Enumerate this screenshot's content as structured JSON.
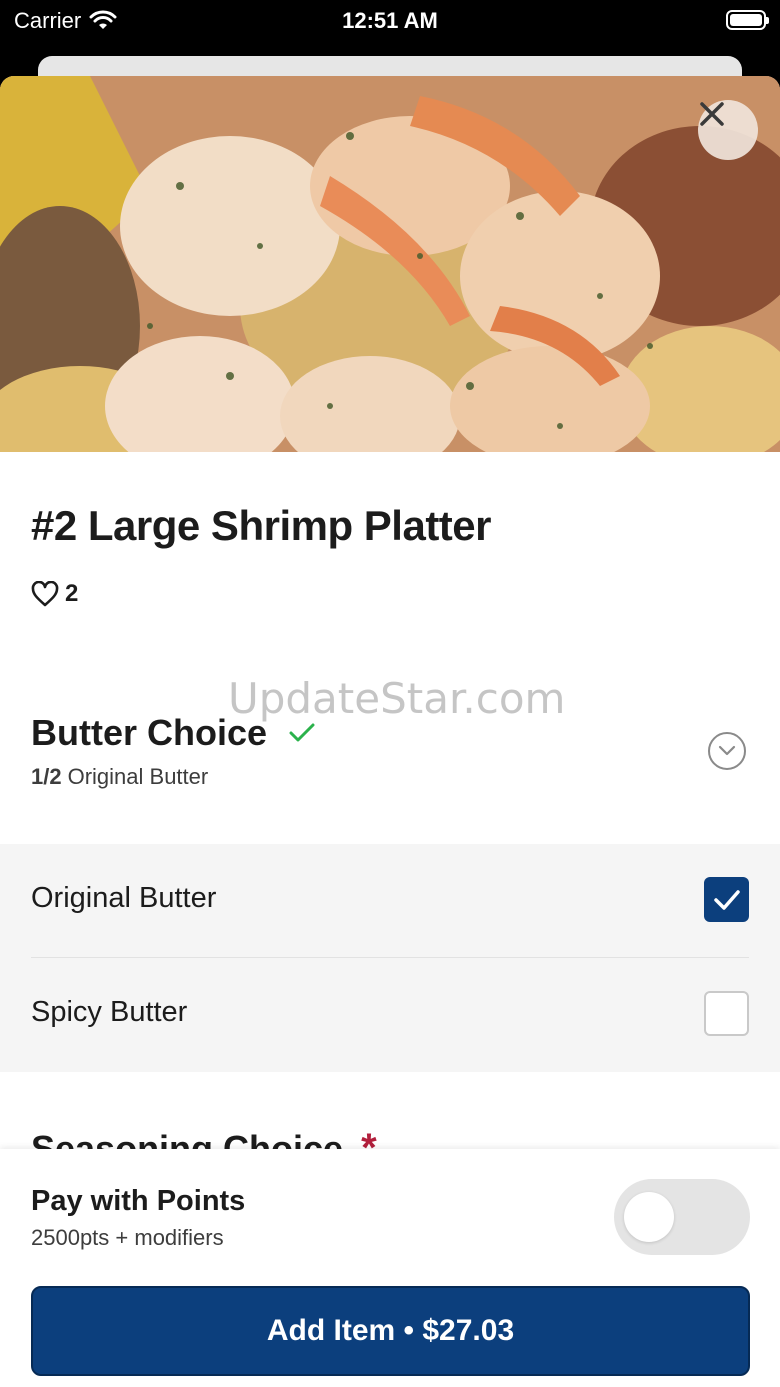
{
  "status_bar": {
    "carrier": "Carrier",
    "time": "12:51 AM",
    "wifi_icon": "wifi-icon",
    "battery_icon": "battery-icon"
  },
  "item": {
    "title": "#2 Large Shrimp Platter",
    "likes": "2"
  },
  "watermark": "UpdateStar.com",
  "butter_section": {
    "title": "Butter Choice",
    "count": "1/2",
    "selected": "Original Butter",
    "options": [
      {
        "label": "Original Butter",
        "checked": true
      },
      {
        "label": "Spicy Butter",
        "checked": false
      }
    ]
  },
  "seasoning_section": {
    "title": "Seasoning Choice",
    "required_mark": "*"
  },
  "footer": {
    "pay_title": "Pay with Points",
    "pay_sub": "2500pts + modifiers",
    "toggle_on": false,
    "add_button": "Add Item • $27.03"
  },
  "colors": {
    "primary": "#0c3f7d",
    "check_green": "#2bb24c",
    "required_red": "#b21f3c"
  }
}
